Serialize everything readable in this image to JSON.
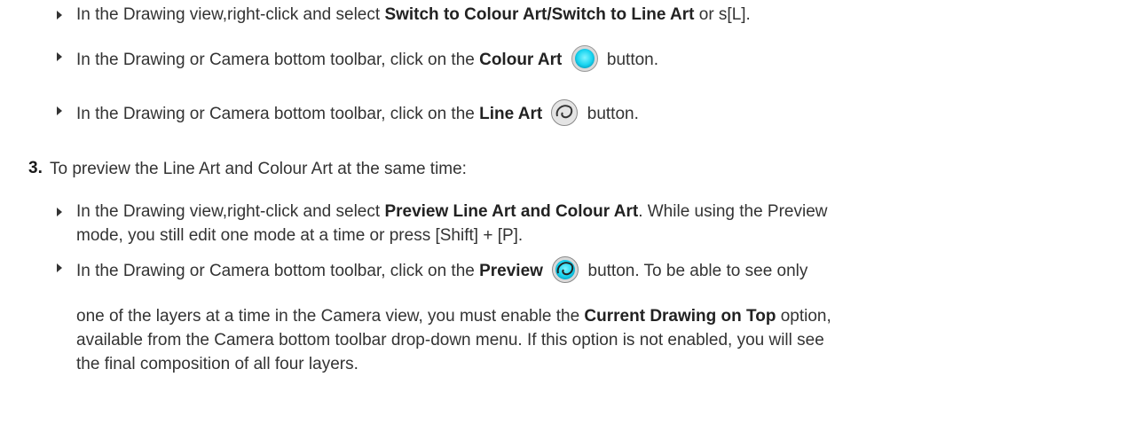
{
  "items": [
    {
      "pre": "In the Drawing view,right-click and select ",
      "b1": "Switch to Colour Art",
      "mid": "/",
      "b2": "Switch to Line Art",
      "post": " or s[L]."
    },
    {
      "pre": "In the Drawing or Camera bottom toolbar, click on the ",
      "b": "Colour Art",
      "post": " button.",
      "icon": "colour-art-icon"
    },
    {
      "pre": "In the Drawing or Camera bottom toolbar, click on the ",
      "b": "Line Art",
      "post": " button.",
      "icon": "line-art-icon"
    },
    {
      "pre": "In the Drawing view,right-click and select ",
      "b": "Preview Line Art and Colour Art",
      "post": ". While using the Preview",
      "cont": "mode, you still edit one mode at a time or press [Shift] + [P]."
    },
    {
      "pre": "In the Drawing or Camera bottom toolbar, click on the ",
      "b": "Preview",
      "post": " button. To be able to see only",
      "icon": "preview-icon"
    }
  ],
  "step3": {
    "number": "3.",
    "text": "To preview the Line Art and Colour Art at the same time:"
  },
  "para": {
    "pre": "one of the layers at a time in the Camera view, you must enable the ",
    "b": "Current Drawing on Top",
    "post": " option,",
    "line2": "available from the Camera bottom toolbar drop-down menu. If this option is not enabled, you will see",
    "line3": "the final composition of all four layers."
  }
}
